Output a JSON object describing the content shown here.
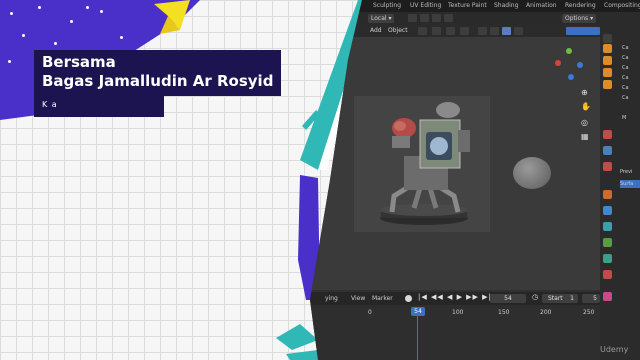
{
  "promo": {
    "title_line1": "Bersama",
    "title_line2": "Bagas Jamalludin Ar Rosyid",
    "subtitle": "K  a"
  },
  "blender": {
    "workspace_tabs": [
      "Sculpting",
      "UV Editing",
      "Texture Paint",
      "Shading",
      "Animation",
      "Rendering",
      "Compositing"
    ],
    "header": {
      "transform_orientation": "Local",
      "options_label": "Options",
      "add_menu": "Add",
      "object_menu": "Object"
    },
    "right_panel": {
      "outliner_rows": [
        "Ca",
        "Ca",
        "Ca",
        "Ca",
        "Ca",
        "Ca"
      ],
      "properties_labels": [
        "M",
        "Previ",
        "Surfa"
      ]
    },
    "timeline": {
      "menus": [
        "ying",
        "View",
        "Marker"
      ],
      "current_frame": "54",
      "start_label": "Start",
      "start_value": "1",
      "end_value": "5",
      "ticks": [
        "0",
        "54",
        "100",
        "150",
        "200",
        "250"
      ]
    },
    "watermark": "Udemy"
  },
  "colors": {
    "brand_navy": "#1c1450",
    "accent_purple": "#4a2fc8",
    "accent_yellow": "#f4e023",
    "accent_teal": "#2fb8b6",
    "blender_blue": "#3d6fc2"
  }
}
